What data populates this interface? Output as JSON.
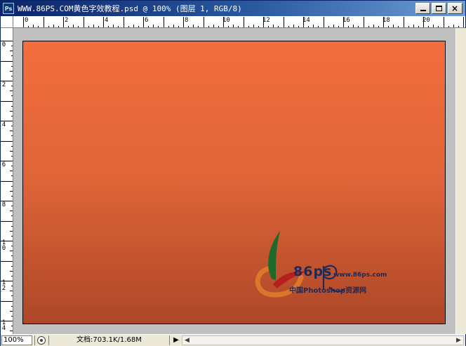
{
  "window": {
    "title": "WWW.86PS.COM黄色字效教程.psd @ 100% (图层 1, RGB/8)",
    "app_icon_text": "Ps"
  },
  "rulers": {
    "top_labels": [
      "0",
      "2",
      "4",
      "6",
      "8",
      "10",
      "12",
      "14",
      "16",
      "18",
      "20"
    ],
    "left_labels": [
      "0",
      "2",
      "4",
      "6",
      "8",
      "10",
      "12",
      "14"
    ]
  },
  "canvas": {
    "gradient_top": "#f36e3f",
    "gradient_bottom": "#ad4728"
  },
  "watermark": {
    "logo_text": "86ps",
    "url": "www.86ps.com",
    "tagline": "中国Photoshop资源网"
  },
  "statusbar": {
    "zoom": "100%",
    "doc_info": "文档:703.1K/1.68M",
    "arrow": "▶"
  },
  "title_buttons": {
    "minimize": "minimize",
    "maximize": "maximize",
    "close": "×"
  }
}
